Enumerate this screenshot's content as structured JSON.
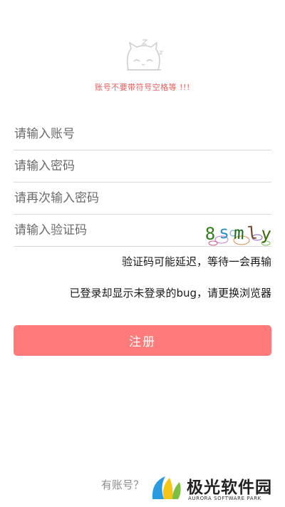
{
  "header": {
    "mascot_icon": "sleepy-cat-icon",
    "warning": "账号不要带符号空格等 !!!",
    "warning_color": "#e65b5b"
  },
  "form": {
    "account_placeholder": "请输入账号",
    "password_placeholder": "请输入密码",
    "confirm_password_placeholder": "请再次输入密码",
    "captcha_placeholder": "请输入验证码",
    "captcha_chars": [
      "8",
      "s",
      "m",
      "l",
      "y"
    ],
    "captcha_colors": [
      "#2e7d1e",
      "#2a8fbf",
      "#1a6b1a",
      "#7a3f2a",
      "#3a6b10"
    ]
  },
  "notes": {
    "captcha_delay": "验证码可能延迟，等待一会再输",
    "login_bug": "已登录却显示未登录的bug，请更换浏览器"
  },
  "actions": {
    "register_label": "注册",
    "register_color": "#ff7b7b",
    "have_account": "有账号？"
  },
  "watermark": {
    "name": "极光软件园",
    "subtitle": "AURORA SOFTWARE PARK"
  }
}
